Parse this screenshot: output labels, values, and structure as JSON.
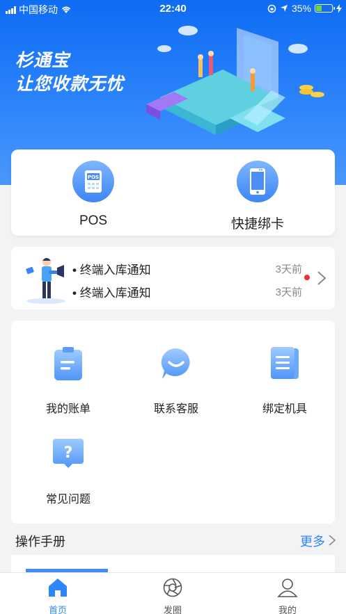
{
  "status_bar": {
    "carrier": "中国移动",
    "time": "22:40",
    "battery": "35%"
  },
  "banner": {
    "line1": "杉通宝",
    "line2": "让您收款无忧"
  },
  "quick_actions": [
    {
      "label": "POS",
      "icon": "pos-icon"
    },
    {
      "label": "快捷绑卡",
      "icon": "phone-icon"
    }
  ],
  "notices": [
    {
      "text": "终端入库通知",
      "time": "3天前"
    },
    {
      "text": "终端入库通知",
      "time": "3天前"
    }
  ],
  "services": [
    {
      "label": "我的账单",
      "icon": "bill-icon"
    },
    {
      "label": "联系客服",
      "icon": "chat-icon"
    },
    {
      "label": "绑定机具",
      "icon": "device-icon"
    },
    {
      "label": "常见问题",
      "icon": "question-icon"
    }
  ],
  "manual": {
    "title": "操作手册",
    "more": "更多"
  },
  "tabs": [
    {
      "label": "首页",
      "icon": "home-icon",
      "active": true
    },
    {
      "label": "发圈",
      "icon": "aperture-icon",
      "active": false
    },
    {
      "label": "我的",
      "icon": "user-icon",
      "active": false
    }
  ],
  "colors": {
    "accent": "#2f86fb",
    "banner": "#0e6cf3",
    "unread": "#f23030"
  }
}
